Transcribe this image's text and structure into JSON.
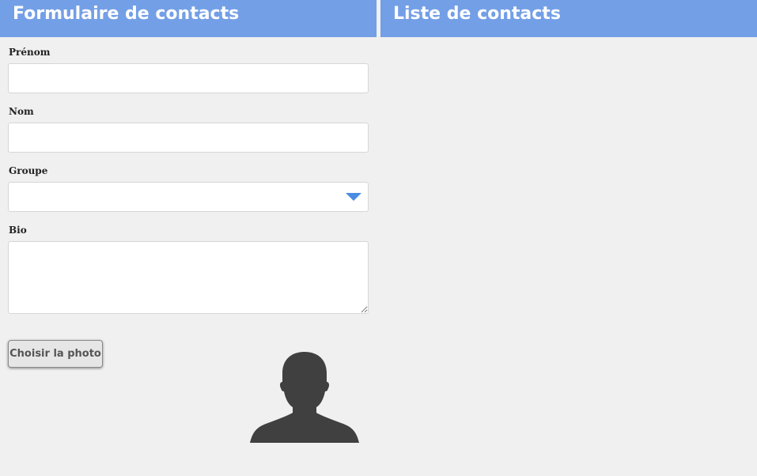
{
  "form_panel": {
    "title": "Formulaire de contacts",
    "fields": {
      "first_name": {
        "label": "Prénom",
        "value": ""
      },
      "last_name": {
        "label": "Nom",
        "value": ""
      },
      "group": {
        "label": "Groupe",
        "selected": ""
      },
      "bio": {
        "label": "Bio",
        "value": ""
      }
    },
    "photo_button_label": "Choisir la photo",
    "avatar_icon": "person-silhouette-icon"
  },
  "list_panel": {
    "title": "Liste de contacts"
  },
  "colors": {
    "header_bg": "#739fe6",
    "page_bg": "#f0f0f0",
    "accent": "#4a8be3",
    "avatar": "#404040"
  }
}
